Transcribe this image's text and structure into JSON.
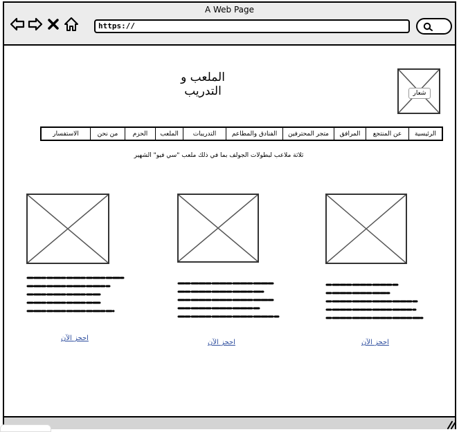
{
  "window": {
    "title": "A Web Page"
  },
  "address_bar": {
    "url": "https://"
  },
  "icons": {
    "back": "back-arrow-icon",
    "forward": "forward-arrow-icon",
    "close": "close-icon",
    "home": "home-icon",
    "search": "search-icon",
    "resize": "resize-grip-icon"
  },
  "header": {
    "logo_label": "شعار",
    "title": "الملعب و التدريب"
  },
  "menu": {
    "items": [
      "الرئيسية",
      "عن المنتجع",
      "المرافق",
      "متجر المحترفين",
      "الفنادق والمطاعم",
      "التدريبات",
      "الملعب",
      "الحزم",
      "من نحن",
      "الاستفسار"
    ]
  },
  "intro": {
    "text": "ثلاثة ملاعب لبطولات الجولف بما في ذلك ملعب \"سي فيو\" الشهير"
  },
  "cards": [
    {
      "link_label": "احجز الآن"
    },
    {
      "link_label": "احجز الآن"
    },
    {
      "link_label": "احجز الآن"
    }
  ],
  "colors": {
    "link": "#2d4d9e",
    "chrome_bg": "#ececec",
    "border": "#000000"
  }
}
